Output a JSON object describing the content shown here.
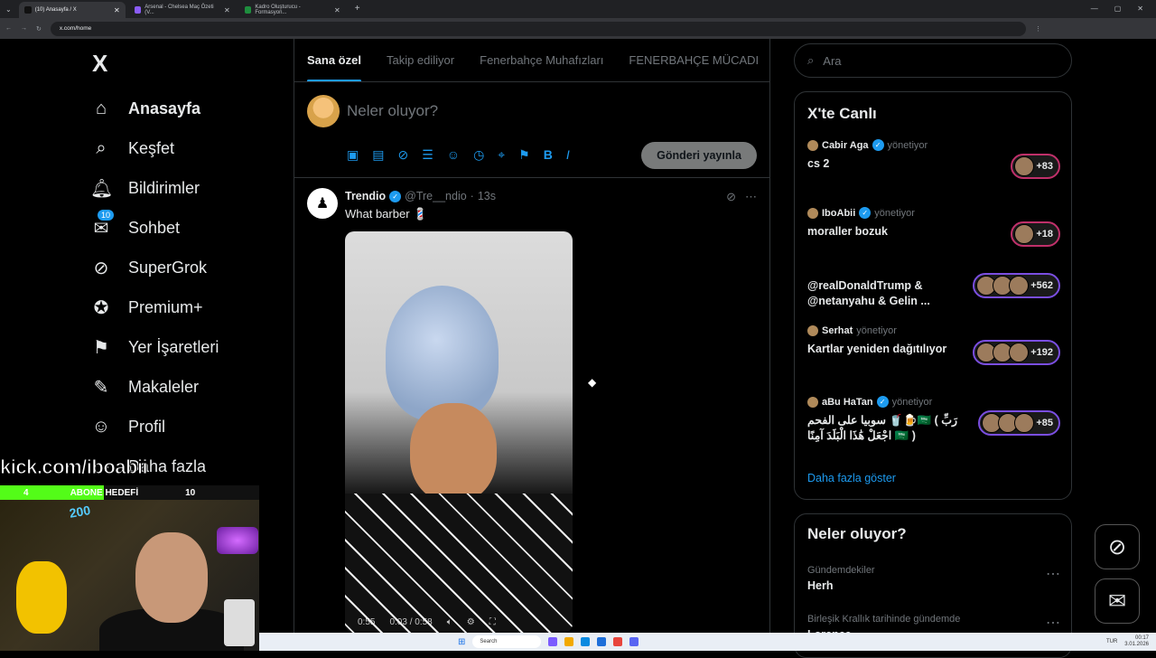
{
  "browser": {
    "tabs": [
      {
        "label": "(10) Anasayfa / X",
        "active": true,
        "color": "#111111"
      },
      {
        "label": "Arsenal - Chelsea Maç Özeti (V...",
        "active": false,
        "color": "#8a5cf6"
      },
      {
        "label": "Kadro Oluşturucu - Formasyon...",
        "active": false,
        "color": "#1e8e3e"
      }
    ],
    "url": "x.com/home"
  },
  "sidebar": {
    "logo": "X",
    "items": [
      {
        "label": "Anasayfa",
        "icon": "home-icon",
        "glyph": "⌂",
        "bold": true
      },
      {
        "label": "Keşfet",
        "icon": "search-icon",
        "glyph": "⌕"
      },
      {
        "label": "Bildirimler",
        "icon": "bell-icon",
        "glyph": "🔔︎"
      },
      {
        "label": "Sohbet",
        "icon": "mail-icon",
        "glyph": "✉",
        "badge": "10"
      },
      {
        "label": "SuperGrok",
        "icon": "grok-icon",
        "glyph": "⊘"
      },
      {
        "label": "Premium+",
        "icon": "verified-icon",
        "glyph": "✪"
      },
      {
        "label": "Yer İşaretleri",
        "icon": "bookmark-icon",
        "glyph": "⚑"
      },
      {
        "label": "Makaleler",
        "icon": "article-icon",
        "glyph": "✎"
      },
      {
        "label": "Profil",
        "icon": "profile-icon",
        "glyph": "☺"
      },
      {
        "label": "Daha fazla",
        "icon": "more-icon",
        "glyph": "⋯"
      }
    ]
  },
  "feed": {
    "tabs": [
      "Sana özel",
      "Takip ediliyor",
      "Fenerbahçe Muhafızları",
      "FENERBAHÇE MÜCADI"
    ],
    "compose": {
      "placeholder": "Neler oluyor?",
      "post_button": "Gönderi yayınla",
      "tools": [
        "image-icon",
        "gif-icon",
        "grok-icon",
        "poll-icon",
        "emoji-icon",
        "schedule-icon",
        "location-icon",
        "flag-icon",
        "bold-icon",
        "italic-icon"
      ],
      "tool_glyphs": [
        "▣",
        "▤",
        "⊘",
        "☰",
        "☺",
        "◷",
        "⌖",
        "⚑",
        "B",
        "I"
      ]
    },
    "tweet": {
      "name": "Trendio",
      "handle": "@Tre__ndio",
      "time": "13s",
      "text": "What barber 💈",
      "video": {
        "elapsed": "0:03",
        "duration": "0:58",
        "prev": "0:55"
      }
    }
  },
  "right": {
    "search_placeholder": "Ara",
    "live": {
      "title": "X'te Canlı",
      "items": [
        {
          "host": "Cabir Aga",
          "role": "yönetiyor",
          "verified": true,
          "title": "cs 2",
          "count": "+83",
          "avatars": 1,
          "ring": "pink"
        },
        {
          "host": "IboAbii",
          "role": "yönetiyor",
          "verified": true,
          "title": "moraller bozuk",
          "count": "+18",
          "avatars": 1,
          "ring": "pink"
        },
        {
          "host": "",
          "role": "",
          "verified": false,
          "title": "@realDonaldTrump & @netanyahu & Gelin ...",
          "count": "+562",
          "avatars": 3,
          "ring": "purple"
        },
        {
          "host": "Serhat",
          "role": "yönetiyor",
          "verified": false,
          "title": "Kartlar yeniden dağıtılıyor",
          "count": "+192",
          "avatars": 3,
          "ring": "purple"
        },
        {
          "host": "aBu HaTan",
          "role": "yönetiyor",
          "verified": true,
          "title": "سوبيا على الفحم 🥤🍺🇸🇦 ( رَبِّ اجْعَلْ هَٰذَا الْبَلَدَ آمِنًا 🇸🇦 )",
          "count": "+85",
          "avatars": 3,
          "ring": "purple"
        }
      ],
      "show_more": "Daha fazla göster"
    },
    "trends": {
      "title": "Neler oluyor?",
      "items": [
        {
          "context": "Gündemdekiler",
          "topic": "Herh"
        },
        {
          "context": "Birleşik Krallık tarihinde gündemde",
          "topic": "Lorence"
        }
      ]
    }
  },
  "stream": {
    "kick_url": "kick.com/iboabii",
    "sub_goal_label": "ABONE HEDEFİ",
    "sub_current": "4",
    "sub_target": "10",
    "sub_progress": 0.4,
    "badge_text": "200"
  },
  "taskbar": {
    "search": "Search",
    "lang": "TUR",
    "time": "00:17",
    "date": "3.01.2026"
  },
  "colors": {
    "accent": "#1d9bf0",
    "kick_green": "#53fc18",
    "live_pink": "#c0306a",
    "live_purple": "#7a4ee0"
  }
}
